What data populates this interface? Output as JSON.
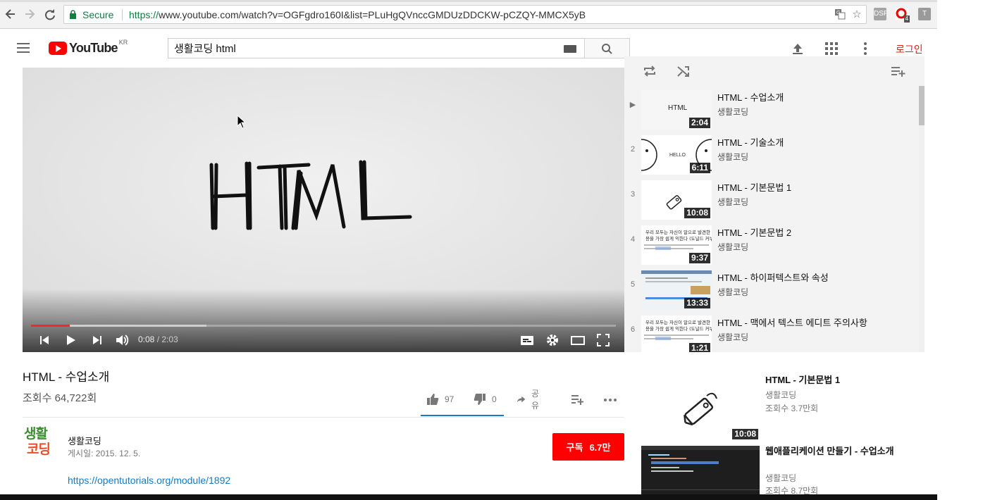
{
  "browser": {
    "secure_label": "Secure",
    "url_scheme": "https://",
    "url_rest": "www.youtube.com/watch?v=OGFgdro160I&list=PLuHgQVnccGMDUzDDCKW-pCZQY-MMCX5yB",
    "ext_badge_count": "4",
    "ext_t_label": "T",
    "ext_dsf_label": "DSF"
  },
  "header": {
    "logo_text": "YouTube",
    "logo_country": "KR",
    "search_value": "생활코딩 html",
    "login_label": "로그인"
  },
  "player": {
    "current_time": "0:08",
    "separator": " / ",
    "total_time": "2:03",
    "played_fraction": 0.066,
    "loaded_fraction": 0.3,
    "canvas_text": "HTML"
  },
  "playlist": {
    "items": [
      {
        "index": "▶",
        "title": "HTML - 수업소개",
        "channel": "생활코딩",
        "duration": "2:04",
        "thumb": "html"
      },
      {
        "index": "2",
        "title": "HTML - 기술소개",
        "channel": "생활코딩",
        "duration": "6:11",
        "thumb": "faces"
      },
      {
        "index": "3",
        "title": "HTML - 기본문법 1",
        "channel": "생활코딩",
        "duration": "10:08",
        "thumb": "tag"
      },
      {
        "index": "4",
        "title": "HTML - 기본문법 2",
        "channel": "생활코딩",
        "duration": "9:37",
        "thumb": "text"
      },
      {
        "index": "5",
        "title": "HTML - 하이퍼텍스트와 속성",
        "channel": "생활코딩",
        "duration": "13:33",
        "thumb": "screen"
      },
      {
        "index": "6",
        "title": "HTML - 맥에서 텍스트 에디트 주의사항",
        "channel": "생활코딩",
        "duration": "1:21",
        "thumb": "text"
      }
    ],
    "thumb_html_text": "HTML",
    "thumb_faces_text": "HELLO",
    "thumb_text_lines": [
      "우리 모두는 자신이 알으로 발견한 내",
      "용을 가장 쉽게 익힌다 (도널드 커누스)"
    ]
  },
  "video": {
    "title": "HTML - 수업소개",
    "views": "조회수 64,722회",
    "likes": "97",
    "dislikes": "0",
    "share_label": "공유",
    "channel_name": "생활코딩",
    "published": "게시일: 2015. 12. 5.",
    "subscribe_label": "구독",
    "subscriber_count": "6.7만",
    "description_link": "https://opentutorials.org/module/1892",
    "avatar_top": "생활",
    "avatar_bottom": "코딩"
  },
  "related": [
    {
      "title": "HTML - 기본문법 1",
      "channel": "생활코딩",
      "views": "조회수 3.7만회",
      "duration": "10:08"
    },
    {
      "title": "웹애플리케이션 만들기 - 수업소개",
      "channel": "생활코딩",
      "views": "조회수 8.7만회"
    }
  ],
  "colors": {
    "yt_red": "#ff0000",
    "progress_red": "#f12b24",
    "link_blue": "#167ac6",
    "secure_green": "#0b8043"
  },
  "icons": [
    "back-arrow-icon",
    "forward-arrow-icon",
    "reload-icon",
    "lock-icon",
    "translate-icon",
    "star-icon",
    "menu-icon",
    "keyboard-icon",
    "search-icon",
    "upload-icon",
    "apps-icon",
    "more-vert-icon",
    "previous-icon",
    "play-icon",
    "next-icon",
    "volume-icon",
    "captions-icon",
    "settings-gear-icon",
    "theater-mode-icon",
    "fullscreen-icon",
    "repeat-icon",
    "shuffle-icon",
    "add-to-playlist-icon",
    "thumbs-up-icon",
    "thumbs-down-icon",
    "share-arrow-icon",
    "more-horiz-icon"
  ]
}
